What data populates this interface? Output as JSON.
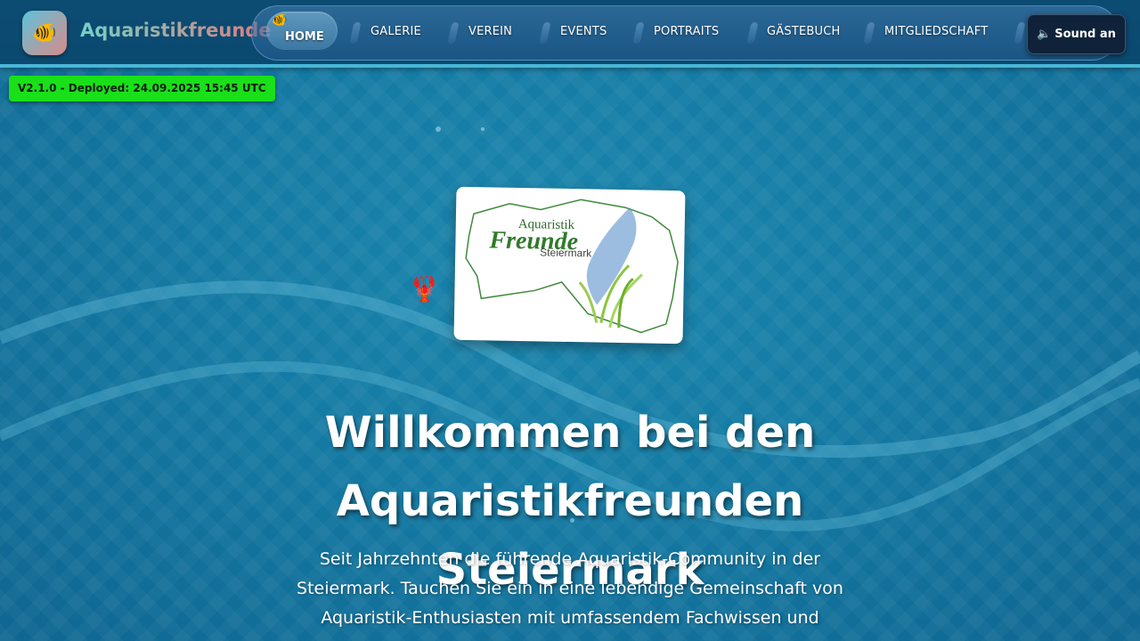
{
  "header": {
    "brand": "Aquaristikfreunde",
    "logo_icon": "fish-icon"
  },
  "nav": {
    "items": [
      {
        "label": "HOME",
        "active": true
      },
      {
        "label": "GALERIE"
      },
      {
        "label": "VEREIN"
      },
      {
        "label": "EVENTS"
      },
      {
        "label": "PORTRAITS"
      },
      {
        "label": "GÄSTEBUCH"
      },
      {
        "label": "MITGLIEDSCHAFT"
      }
    ]
  },
  "sound_button": {
    "label": "Sound an",
    "icon": "speaker-muted-icon"
  },
  "version_badge": "V2.1.0 - Deployed: 24.09.2025 15:45 UTC",
  "logo_card": {
    "line1": "Aquaristik",
    "line2": "Freunde",
    "line3": "Steiermark"
  },
  "hero": {
    "title_line1": "Willkommen bei den Aquaristikfreunden",
    "title_line2": "Steiermark",
    "text_line1": "Seit Jahrzehnten die führende Aquaristik-Community in der",
    "text_line2": "Steiermark. Tauchen Sie ein in eine lebendige Gemeinschaft von",
    "text_line3": "Aquaristik-Enthusiasten mit umfassendem Fachwissen und"
  },
  "colors": {
    "header_bg": "#0b4a70",
    "water": "#147aa3",
    "badge_green": "#19e019",
    "brand_start": "#74d2c7",
    "brand_end": "#e07a7a"
  }
}
